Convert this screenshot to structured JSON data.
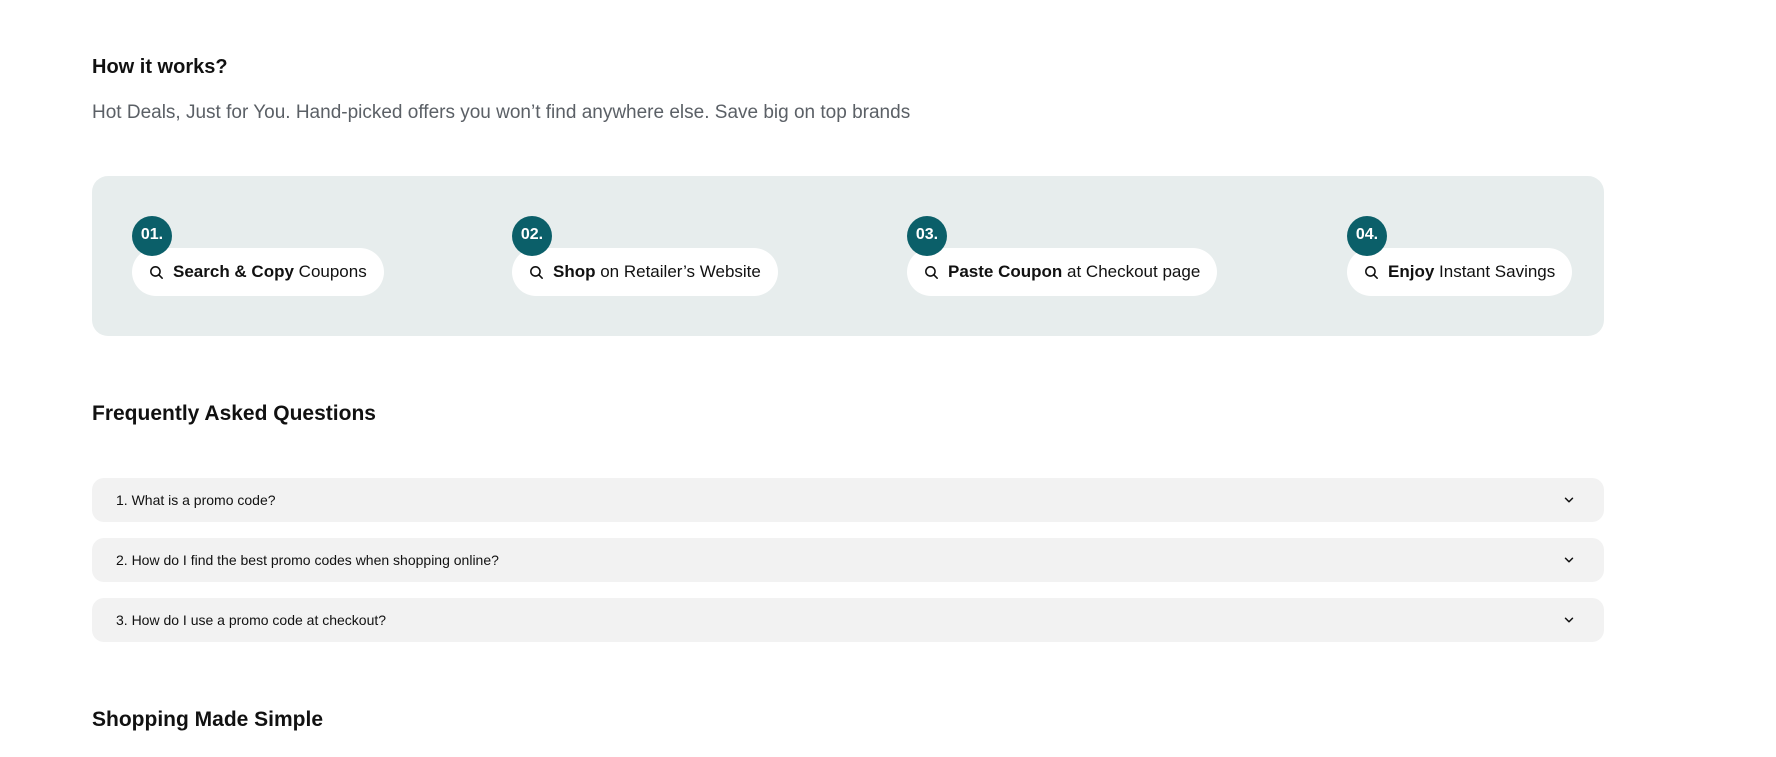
{
  "how_it_works": {
    "title": "How it works?",
    "subtitle": "Hot Deals, Just for You. Hand-picked offers you won’t find anywhere else. Save big on top brands",
    "steps": [
      {
        "number": "01.",
        "bold": "Search & Copy",
        "rest": " Coupons",
        "icon": "search-icon"
      },
      {
        "number": "02.",
        "bold": "Shop",
        "rest": " on Retailer’s Website",
        "icon": "search-icon"
      },
      {
        "number": "03.",
        "bold": "Paste Coupon",
        "rest": " at Checkout page",
        "icon": "search-icon"
      },
      {
        "number": "04.",
        "bold": "Enjoy",
        "rest": " Instant Savings",
        "icon": "search-icon"
      }
    ]
  },
  "faq": {
    "title": "Frequently Asked Questions",
    "items": [
      {
        "question": "1. What is a promo code?",
        "icon": "chevron-down-icon"
      },
      {
        "question": "2. How do I find the best promo codes when shopping online?",
        "icon": "chevron-down-icon"
      },
      {
        "question": "3. How do I use a promo code at checkout?",
        "icon": "chevron-down-icon"
      }
    ]
  },
  "shopping_section": {
    "title": "Shopping Made Simple"
  },
  "colors": {
    "accent": "#0b5f69",
    "panel_bg": "#e7eded",
    "faq_bg": "#f2f2f2",
    "subtitle_text": "#5b6066"
  }
}
